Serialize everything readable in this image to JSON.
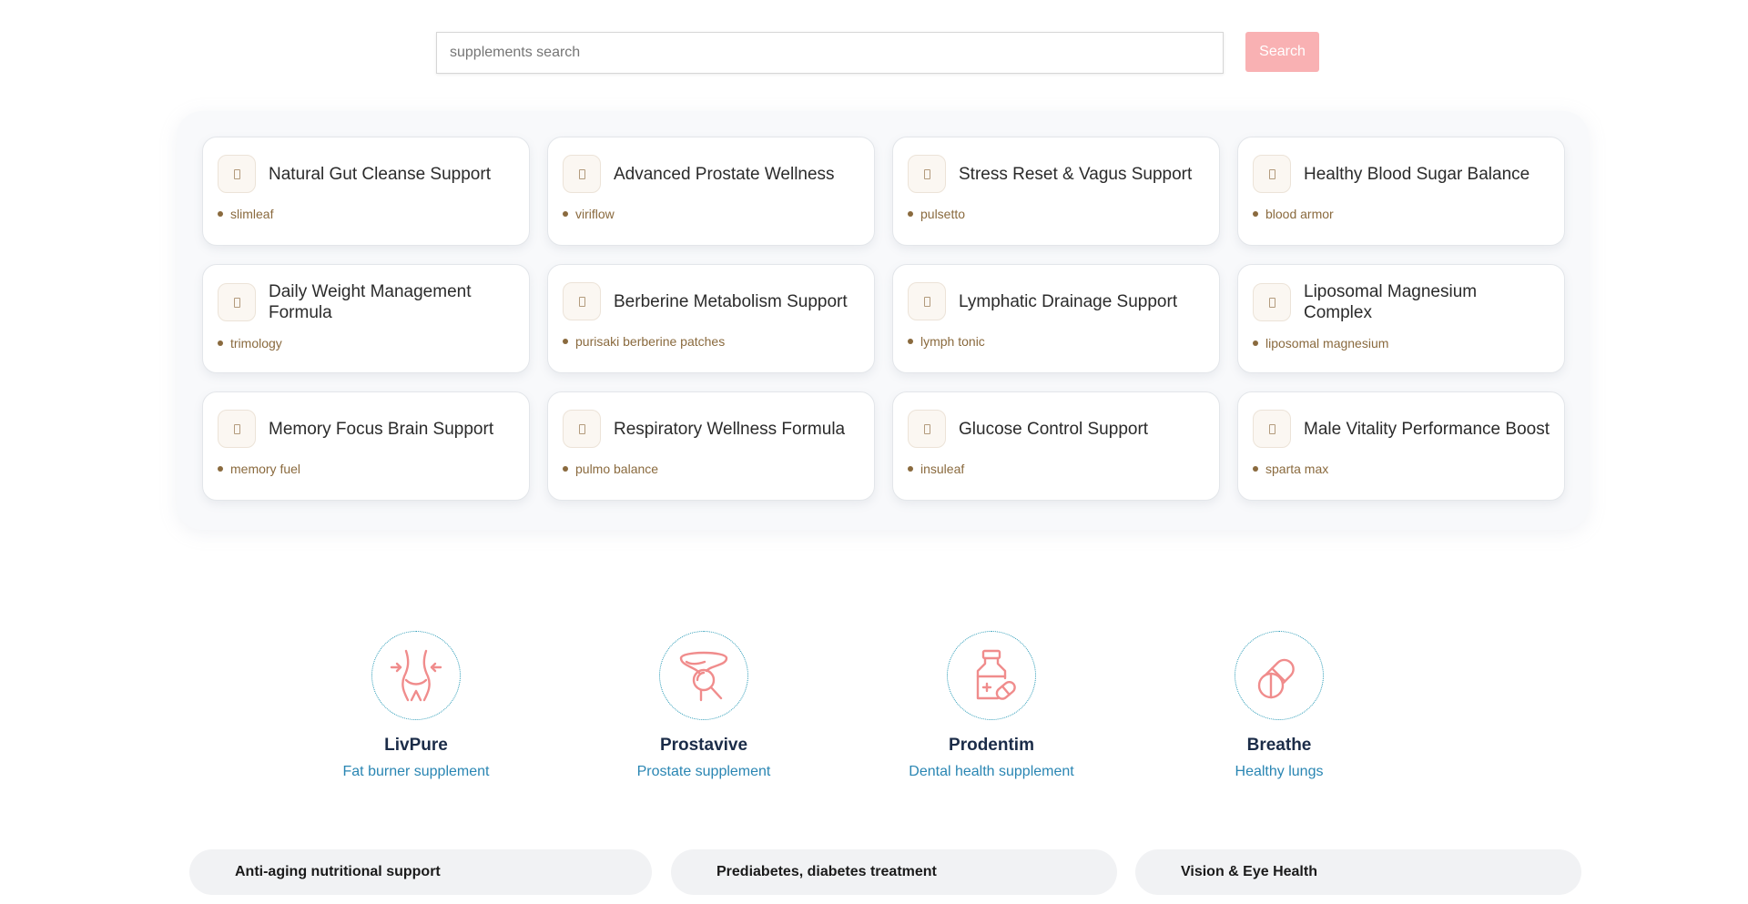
{
  "search": {
    "placeholder": "supplements search",
    "button_label": "Search"
  },
  "cards": [
    {
      "title": "Natural Gut Cleanse Support",
      "tag": "slimleaf"
    },
    {
      "title": "Advanced Prostate Wellness",
      "tag": "viriflow"
    },
    {
      "title": "Stress Reset & Vagus Support",
      "tag": "pulsetto"
    },
    {
      "title": "Healthy Blood Sugar Balance",
      "tag": "blood armor"
    },
    {
      "title": "Daily Weight Management Formula",
      "tag": "trimology"
    },
    {
      "title": "Berberine Metabolism Support",
      "tag": "purisaki berberine patches"
    },
    {
      "title": "Lymphatic Drainage Support",
      "tag": "lymph tonic"
    },
    {
      "title": "Liposomal Magnesium Complex",
      "tag": "liposomal magnesium"
    },
    {
      "title": "Memory Focus Brain Support",
      "tag": "memory fuel"
    },
    {
      "title": "Respiratory Wellness Formula",
      "tag": "pulmo balance"
    },
    {
      "title": "Glucose Control Support",
      "tag": "insuleaf"
    },
    {
      "title": "Male Vitality Performance Boost",
      "tag": "sparta max"
    }
  ],
  "features": [
    {
      "name": "LivPure",
      "desc": "Fat burner supplement",
      "icon": "waist-icon"
    },
    {
      "name": "Prostavive",
      "desc": "Prostate supplement",
      "icon": "prostate-search-icon"
    },
    {
      "name": "Prodentim",
      "desc": "Dental health supplement",
      "icon": "medicine-bottle-icon"
    },
    {
      "name": "Breathe",
      "desc": "Healthy lungs",
      "icon": "pills-icon"
    }
  ],
  "categories": [
    "Anti-aging nutritional support",
    "Prediabetes, diabetes treatment",
    "Vision & Eye Health"
  ],
  "colors": {
    "search_button": "#f9b1b3",
    "tag_text": "#8a6a3e",
    "feature_name": "#1b2c48",
    "feature_desc": "#2a86b3",
    "icon_stroke": "#f08c8c"
  }
}
